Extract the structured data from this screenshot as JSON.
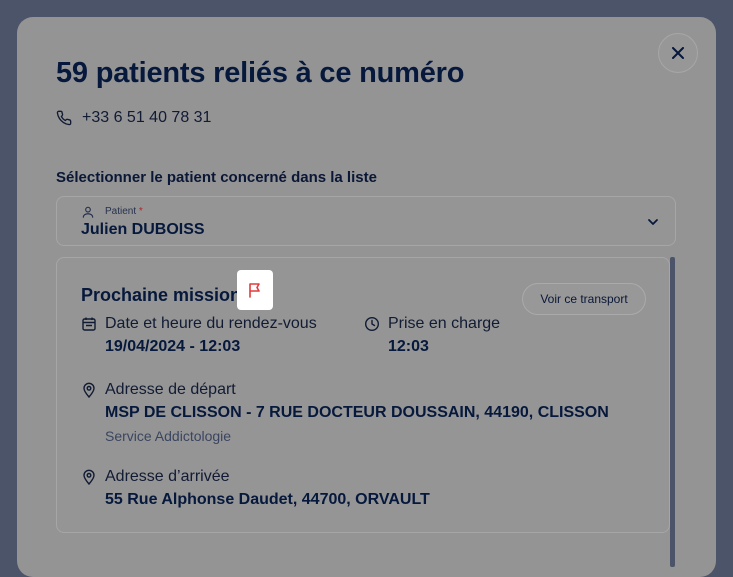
{
  "modal": {
    "title": "59 patients reliés à ce numéro",
    "phone": "+33 6 51 40 78 31",
    "select_label": "Sélectionner le patient concerné dans la liste",
    "patient_field": {
      "label": "Patient",
      "required_mark": "*",
      "value": "Julien DUBOISS"
    }
  },
  "mission": {
    "title": "Prochaine mission",
    "view_button": "Voir ce transport",
    "appointment": {
      "label": "Date et heure du rendez-vous",
      "value": "19/04/2024 - 12:03"
    },
    "pickup": {
      "label": "Prise en charge",
      "value": "12:03"
    },
    "departure": {
      "label": "Adresse de départ",
      "value": "MSP DE CLISSON - 7 RUE DOCTEUR DOUSSAIN, 44190, CLISSON",
      "service": "Service Addictologie"
    },
    "arrival": {
      "label": "Adresse d’arrivée",
      "value": "55 Rue Alphonse Daudet, 44700, ORVAULT"
    }
  },
  "icons": {
    "close": "close-icon",
    "phone": "phone-icon",
    "user": "user-icon",
    "chevron": "chevron-down-icon",
    "flag": "flag-icon",
    "calendar": "calendar-icon",
    "clock": "clock-icon",
    "pin": "map-pin-icon"
  },
  "colors": {
    "navy": "#06183c",
    "flag_red": "#e23b3b",
    "required_red": "#b3262b"
  }
}
